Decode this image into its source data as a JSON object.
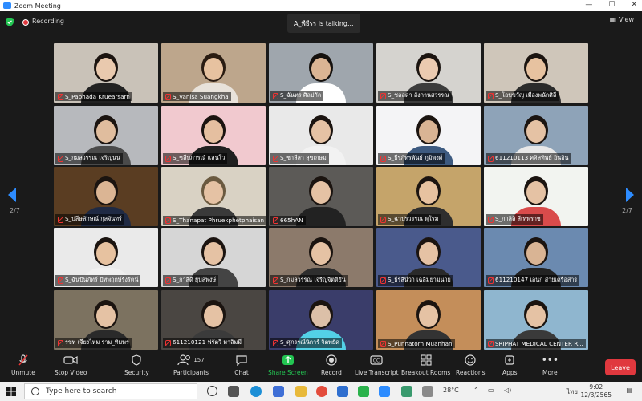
{
  "window": {
    "title": "Zoom Meeting"
  },
  "topbar": {
    "recording_label": "Recording",
    "talking_label": "A_พีธีรร is  talking...",
    "view_label": "View"
  },
  "pagination": {
    "left": "2/7",
    "right": "2/7"
  },
  "participants_count": "157",
  "tiles": [
    {
      "name": "S_Paphada Kruearsarn",
      "muted": true,
      "bg": "#c9c2b8",
      "skin": "#e9c9ae",
      "shirt": "#222222",
      "hair": "#1b1410"
    },
    {
      "name": "S_Vanisa Suangkha",
      "muted": true,
      "bg": "#bda68c",
      "skin": "#e7c2a0",
      "shirt": "#e8e2da",
      "hair": "#2a1c12"
    },
    {
      "name": "S_ฉันทร ศิลปกัล",
      "muted": true,
      "bg": "#9fa6ad",
      "skin": "#dbb594",
      "shirt": "#ffffff",
      "hair": "#15110e"
    },
    {
      "name": "S_ชลลดา อังกานสวรรณ",
      "muted": true,
      "bg": "#d5d3cf",
      "skin": "#ebcab0",
      "shirt": "#3c3c3c",
      "hair": "#1b1410"
    },
    {
      "name": "S_โอบขวัญ เมืองพนักศิลี",
      "muted": true,
      "bg": "#cfc6ba",
      "skin": "#e7c2a0",
      "shirt": "#2b2b2b",
      "hair": "#1b1410"
    },
    {
      "name": "S_กมลวรรณ เจริญนน",
      "muted": true,
      "bg": "#b7b9bd",
      "skin": "#e0bd9e",
      "shirt": "#4a4a4a",
      "hair": "#1b1410"
    },
    {
      "name": "S_ชลีบภารณ์ แสนโว",
      "muted": true,
      "bg": "#f1c9cf",
      "skin": "#e5bfa0",
      "shirt": "#202020",
      "hair": "#1b1410"
    },
    {
      "name": "S_ชาลีลา สุขเกษม",
      "muted": true,
      "bg": "#e9e9e9",
      "skin": "#e5c2a4",
      "shirt": "#f2f2f2",
      "hair": "#1b1410"
    },
    {
      "name": "S_ธีรภัทรพันธ์ ภูมิพงศ์",
      "muted": true,
      "bg": "#f4f4f6",
      "skin": "#d9b494",
      "shirt": "#3d5a80",
      "hair": "#1b1410"
    },
    {
      "name": "611210113 ศศิลทิพย์ อินอิน",
      "muted": true,
      "bg": "#8ea3b8",
      "skin": "#e5c2a4",
      "shirt": "#e8e8e8",
      "hair": "#1b1410"
    },
    {
      "name": "S_ปลีษลักษณ์ กุลจันทร์",
      "muted": true,
      "bg": "#5a3d22",
      "skin": "#dbb594",
      "shirt": "#1f2a44",
      "hair": "#1b1410"
    },
    {
      "name": "S_Thanapat Phruekphetphaisan",
      "muted": true,
      "bg": "#d9d2c4",
      "skin": "#e5c2a4",
      "shirt": "#3a3a3a",
      "hair": "#6b5a40"
    },
    {
      "name": "665hAN",
      "muted": true,
      "bg": "#5c5a57",
      "skin": "#e5c2a4",
      "shirt": "#222222",
      "hair": "#1b1410"
    },
    {
      "name": "S_ฉาปุรวรรณ พุโรม",
      "muted": true,
      "bg": "#c5a46a",
      "skin": "#e7c2a0",
      "shirt": "#2e2e2e",
      "hair": "#1b1410"
    },
    {
      "name": "S_กาลิลิ สีเทพราช",
      "muted": true,
      "bg": "#f2f4f0",
      "skin": "#e5c2a4",
      "shirt": "#d94b4b",
      "hair": "#1b1410"
    },
    {
      "name": "S_ฉันปันภัทร์ ปัทพฤกษ์รุ้งรัตน์",
      "muted": true,
      "bg": "#eaeaea",
      "skin": "#e7c2a0",
      "shirt": "#f0f0f0",
      "hair": "#1b1410"
    },
    {
      "name": "S_กาลิดิ ยุบลพงษ์",
      "muted": true,
      "bg": "#d6d6d6",
      "skin": "#e5c2a4",
      "shirt": "#444444",
      "hair": "#1b1410"
    },
    {
      "name": "S_กมลวรรณ เจริญจิตติยัน",
      "muted": true,
      "bg": "#8c7a6b",
      "skin": "#e5c2a4",
      "shirt": "#2e2e2e",
      "hair": "#1b1410"
    },
    {
      "name": "S_ธีรลินีวา เฉลิมยามนาย",
      "muted": true,
      "bg": "#4a5a8c",
      "skin": "#e5c2a4",
      "shirt": "#2a2a2a",
      "hair": "#1b1410"
    },
    {
      "name": "611210147 เอนก สายเครือสาร",
      "muted": true,
      "bg": "#6b8ab0",
      "skin": "#d9b494",
      "shirt": "#222222",
      "hair": "#1b1410"
    },
    {
      "name": "รขท เจียงไหม ราม_ทิมพร",
      "muted": true,
      "bg": "#7c7260",
      "skin": "#e5c2a4",
      "shirt": "#2a2a2a",
      "hair": "#1b1410"
    },
    {
      "name": "611210121 ฟรัตวี มาลิมมี",
      "muted": true,
      "bg": "#4a4642",
      "skin": "#e5c2a4",
      "shirt": "#3b3b3b",
      "hair": "#1b1410"
    },
    {
      "name": "S_ศุภรรณ์นิการ์ จิตพยัด",
      "muted": true,
      "bg": "#3a3d6a",
      "skin": "#dcc0a8",
      "shirt": "#53d1e6",
      "hair": "#1b1410"
    },
    {
      "name": "S_Punnatorn Muanhan",
      "muted": true,
      "bg": "#c48e5a",
      "skin": "#e5c2a4",
      "shirt": "#333333",
      "hair": "#1b1410"
    },
    {
      "name": "SRIPHAT MEDICAL CENTER R...",
      "muted": true,
      "bg": "#8fb6cf",
      "skin": "#e5c2a4",
      "shirt": "#3a3a3a",
      "hair": "#1b1410"
    }
  ],
  "toolbar": {
    "unmute": "Unmute",
    "stop_video": "Stop Video",
    "security": "Security",
    "participants": "Participants",
    "chat": "Chat",
    "share_screen": "Share Screen",
    "record": "Record",
    "live_transcript": "Live Transcript",
    "breakout_rooms": "Breakout Rooms",
    "reactions": "Reactions",
    "apps": "Apps",
    "more": "More",
    "leave": "Leave"
  },
  "taskbar": {
    "search_placeholder": "Type here to search",
    "weather": "28°C",
    "language": "ไทย",
    "time": "9:02",
    "date": "12/3/2565"
  },
  "colors": {
    "accent": "#2d8cff",
    "leave": "#e0383e",
    "share": "#23c552",
    "muted": "#e33333"
  }
}
